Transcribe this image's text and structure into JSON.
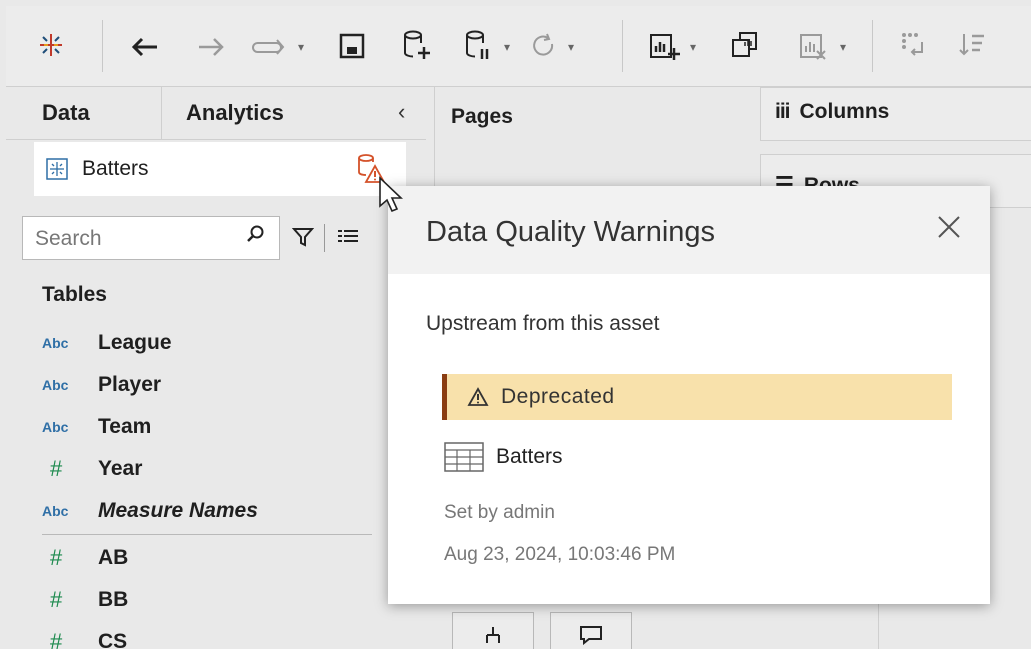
{
  "tabs": {
    "data": "Data",
    "analytics": "Analytics"
  },
  "datasource": {
    "name": "Batters"
  },
  "search": {
    "placeholder": "Search"
  },
  "fields": {
    "tables_heading": "Tables",
    "dimensions": [
      {
        "type": "Abc",
        "name": "League"
      },
      {
        "type": "Abc",
        "name": "Player"
      },
      {
        "type": "Abc",
        "name": "Team"
      },
      {
        "type": "#",
        "name": "Year"
      },
      {
        "type": "Abc",
        "name": "Measure Names"
      }
    ],
    "measures": [
      {
        "type": "#",
        "name": "AB"
      },
      {
        "type": "#",
        "name": "BB"
      },
      {
        "type": "#",
        "name": "CS"
      }
    ]
  },
  "shelves": {
    "pages": "Pages",
    "columns": "Columns",
    "rows": "Rows"
  },
  "popover": {
    "title": "Data Quality Warnings",
    "subtitle": "Upstream from this asset",
    "warning_label": "Deprecated",
    "asset_name": "Batters",
    "set_by": "Set by admin",
    "timestamp": "Aug 23, 2024, 10:03:46 PM"
  },
  "colors": {
    "warning_fill": "#f8e1ab",
    "warning_bar": "#8a3d12",
    "warning_icon": "#d4522a",
    "number_type": "#1d8a4e",
    "text_type": "#2f6fa6"
  },
  "icons": {
    "logo": "tableau-logo-icon",
    "back": "arrow-left-icon",
    "forward": "arrow-right-icon",
    "redo": "redo-icon",
    "save": "save-icon",
    "new_datasource": "new-datasource-icon",
    "pause": "pause-datasource-icon",
    "refresh": "refresh-icon",
    "new_sheet": "new-worksheet-icon",
    "duplicate": "duplicate-sheet-icon",
    "clear": "clear-sheet-icon",
    "swap": "swap-icon",
    "sort": "sort-icon",
    "filter": "filter-icon",
    "view_list": "view-list-icon",
    "warning": "warning-icon",
    "table": "table-icon",
    "close": "close-icon"
  }
}
